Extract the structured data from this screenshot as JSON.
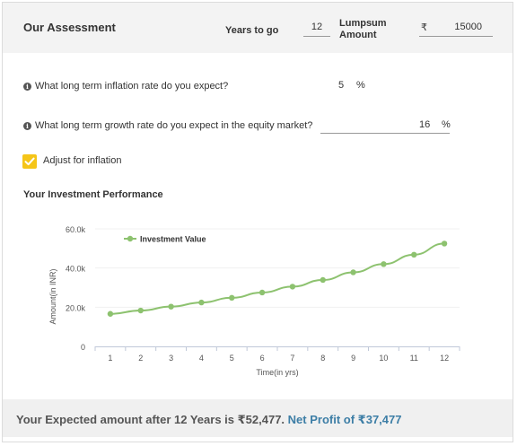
{
  "header": {
    "title": "Our Assessment",
    "years_label": "Years to go",
    "years_value": "12",
    "lumpsum_label_line1": "Lumpsum",
    "lumpsum_label_line2": "Amount",
    "currency_symbol": "₹",
    "lumpsum_value": "15000"
  },
  "inflation": {
    "question": "What long term inflation rate do you expect?",
    "value": "5",
    "unit": "%"
  },
  "growth": {
    "question": "What long term growth rate do you expect in the equity market?",
    "value": "16",
    "unit": "%"
  },
  "adjust": {
    "label": "Adjust for inflation",
    "checked": true
  },
  "performance_title": "Your Investment Performance",
  "chart_data": {
    "type": "line",
    "xlabel": "Time(in yrs)",
    "ylabel": "Amount(in INR)",
    "ylim": [
      0,
      60000
    ],
    "yticks": [
      "0",
      "20.0k",
      "40.0k",
      "60.0k"
    ],
    "x": [
      1,
      2,
      3,
      4,
      5,
      6,
      7,
      8,
      9,
      10,
      11,
      12
    ],
    "series": [
      {
        "name": "Investment Value",
        "color": "#8dc26f",
        "values": [
          16600,
          18300,
          20300,
          22400,
          24800,
          27500,
          30500,
          33900,
          37800,
          42000,
          46800,
          52477
        ]
      }
    ],
    "legend": "top-left"
  },
  "footer": {
    "main_text": "Your Expected amount after 12 Years is ₹52,477.",
    "profit_text": "Net Profit of ₹37,477"
  }
}
